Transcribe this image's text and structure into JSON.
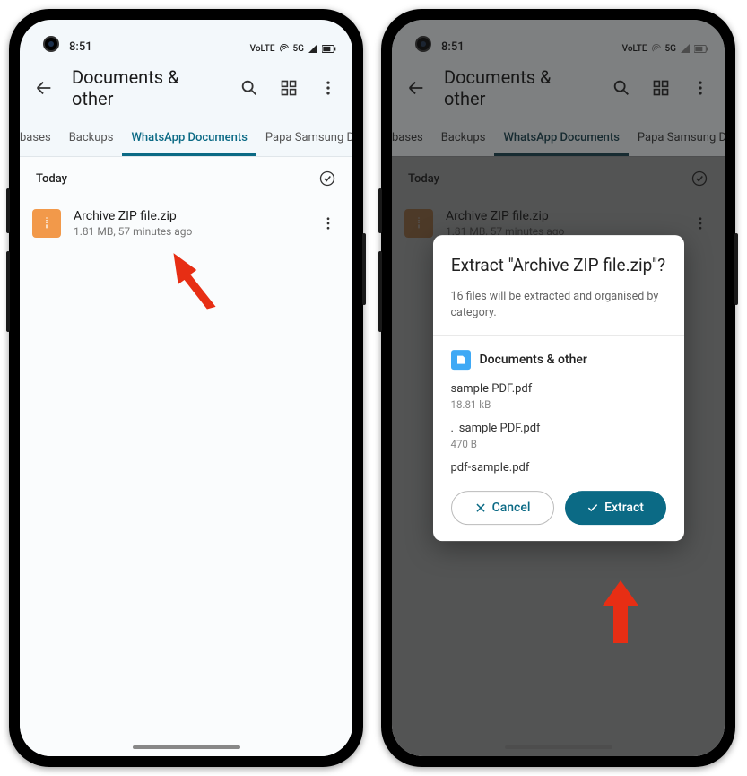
{
  "status": {
    "time": "8:51",
    "lte": "VoLTE",
    "fiveg": "5G"
  },
  "appbar": {
    "title": "Documents & other"
  },
  "tabs": {
    "t0": "bases",
    "t1": "Backups",
    "t2": "WhatsApp Documents",
    "t3": "Papa Samsung Do"
  },
  "list": {
    "section": "Today",
    "file_name": "Archive ZIP file.zip",
    "file_sub": "1.81 MB, 57 minutes ago"
  },
  "dialog": {
    "title": "Extract \"Archive ZIP file.zip\"?",
    "sub": "16 files will be extracted and organised by category.",
    "category": "Documents & other",
    "items": [
      {
        "name": "sample PDF.pdf",
        "size": "18.81 kB"
      },
      {
        "name": "._sample PDF.pdf",
        "size": "470 B"
      },
      {
        "name": "pdf-sample.pdf",
        "size": ""
      }
    ],
    "cancel": "Cancel",
    "extract": "Extract"
  }
}
